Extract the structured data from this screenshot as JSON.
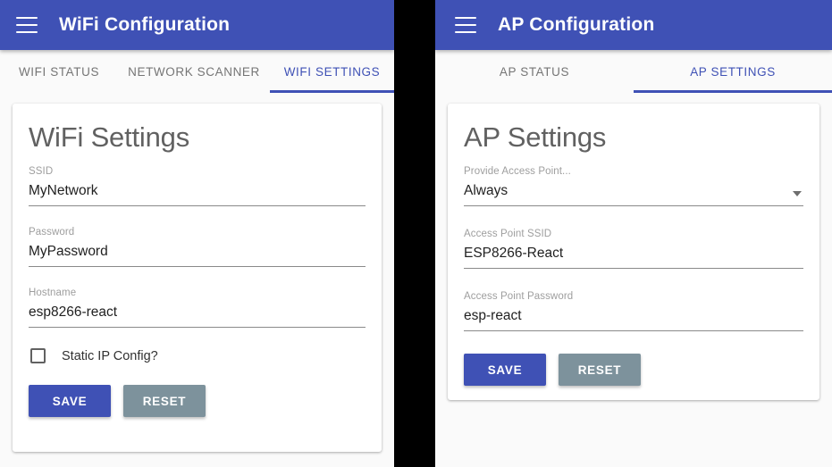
{
  "left_panel": {
    "appbar": {
      "menu_icon": "hamburger-menu-icon",
      "title": "WiFi Configuration"
    },
    "tabs": [
      {
        "label": "WIFI STATUS",
        "active": false
      },
      {
        "label": "NETWORK SCANNER",
        "active": false
      },
      {
        "label": "WIFI SETTINGS",
        "active": true
      }
    ],
    "card": {
      "title": "WiFi Settings",
      "fields": [
        {
          "label": "SSID",
          "value": "MyNetwork",
          "type": "text"
        },
        {
          "label": "Password",
          "value": "MyPassword",
          "type": "text"
        },
        {
          "label": "Hostname",
          "value": "esp8266-react",
          "type": "text"
        }
      ],
      "checkbox": {
        "label": "Static IP Config?",
        "checked": false
      },
      "buttons": {
        "save": "SAVE",
        "reset": "RESET"
      }
    }
  },
  "right_panel": {
    "appbar": {
      "menu_icon": "hamburger-menu-icon",
      "title": "AP Configuration"
    },
    "tabs": [
      {
        "label": "AP STATUS",
        "active": false
      },
      {
        "label": "AP SETTINGS",
        "active": true
      }
    ],
    "card": {
      "title": "AP Settings",
      "fields": [
        {
          "label": "Provide Access Point...",
          "value": "Always",
          "type": "select"
        },
        {
          "label": "Access Point SSID",
          "value": "ESP8266-React",
          "type": "text"
        },
        {
          "label": "Access Point Password",
          "value": "esp-react",
          "type": "text"
        }
      ],
      "buttons": {
        "save": "SAVE",
        "reset": "RESET"
      }
    }
  },
  "colors": {
    "primary": "#3f51b5",
    "reset_button": "#7d929c",
    "page_background": "#fafafa",
    "card_background": "#ffffff",
    "divider": "#000000"
  }
}
